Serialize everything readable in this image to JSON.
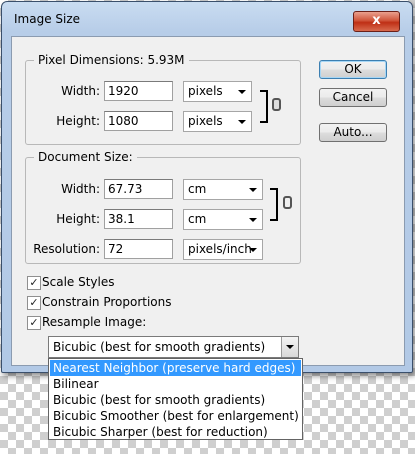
{
  "window": {
    "title": "Image Size",
    "close_label": "x"
  },
  "pixel_dimensions": {
    "legend": "Pixel Dimensions:  5.93M",
    "width_label": "Width:",
    "width_value": "1920",
    "width_unit": "pixels",
    "height_label": "Height:",
    "height_value": "1080",
    "height_unit": "pixels"
  },
  "document_size": {
    "legend": "Document Size:",
    "width_label": "Width:",
    "width_value": "67.73",
    "width_unit": "cm",
    "height_label": "Height:",
    "height_value": "38.1",
    "height_unit": "cm",
    "resolution_label": "Resolution:",
    "resolution_value": "72",
    "resolution_unit": "pixels/inch"
  },
  "buttons": {
    "ok": "OK",
    "cancel": "Cancel",
    "auto": "Auto..."
  },
  "options": {
    "scale_styles": {
      "label": "Scale Styles",
      "checked": true
    },
    "constrain_proportions": {
      "label": "Constrain Proportions",
      "checked": true
    },
    "resample_image": {
      "label": "Resample Image:",
      "checked": true
    }
  },
  "resample": {
    "selected": "Bicubic (best for smooth gradients)",
    "items": [
      "Nearest Neighbor (preserve hard edges)",
      "Bilinear",
      "Bicubic (best for smooth gradients)",
      "Bicubic Smoother (best for enlargement)",
      "Bicubic Sharper (best for reduction)"
    ],
    "highlighted": "Nearest Neighbor (preserve hard edges)"
  },
  "icons": {
    "close": "close-icon",
    "chain": "link-chain-icon",
    "check": "checkmark-icon",
    "dropdown": "chevron-down-icon"
  },
  "colors": {
    "title_bar": "#b7cde8",
    "close_button": "#c4391d",
    "highlight": "#3399ff",
    "dialog_bg": "#f0f0f0"
  }
}
